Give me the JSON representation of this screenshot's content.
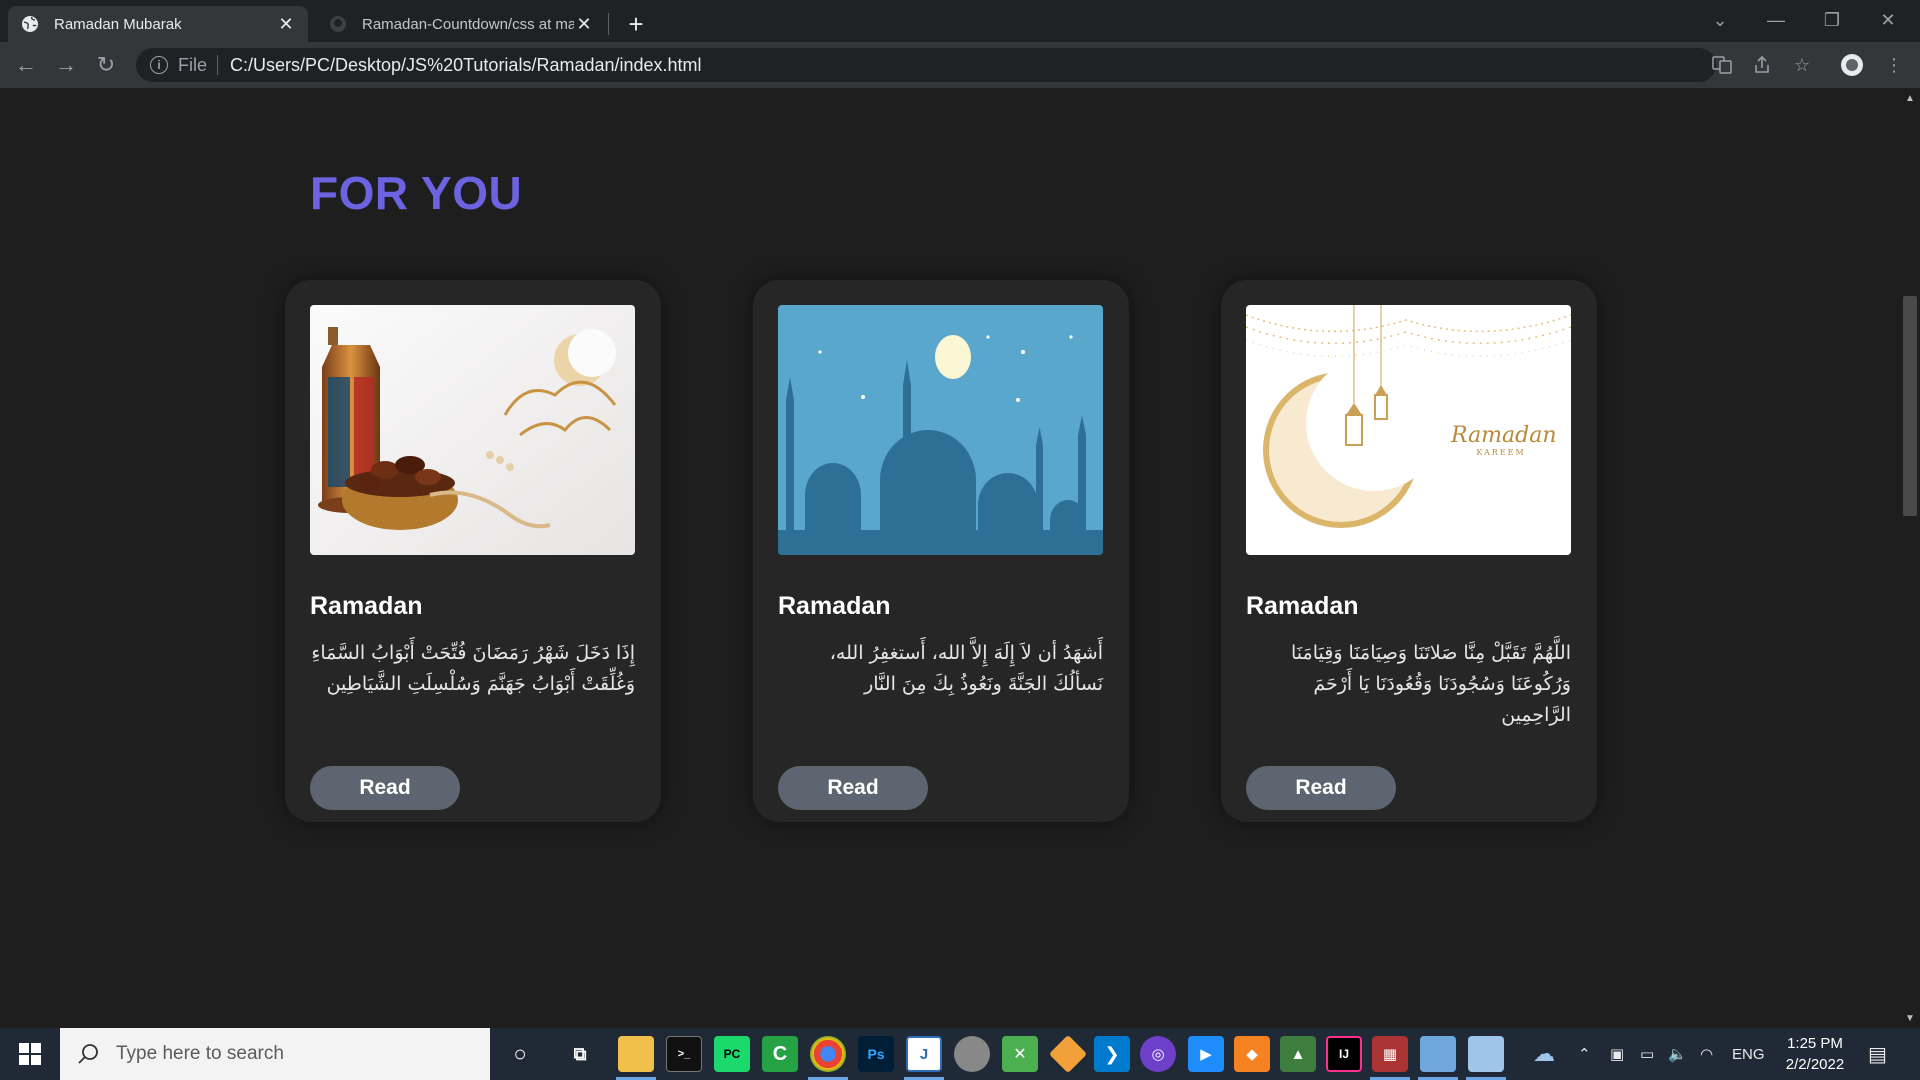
{
  "browser": {
    "tabs": [
      {
        "title": "Ramadan Mubarak",
        "active": true
      },
      {
        "title": "Ramadan-Countdown/css at main",
        "active": false
      }
    ],
    "address": {
      "scheme_label": "File",
      "url": "C:/Users/PC/Desktop/JS%20Tutorials/Ramadan/index.html"
    }
  },
  "page": {
    "section_title": "FOR YOU",
    "accent_color": "#6c63e0",
    "cards": [
      {
        "image": "lantern-dates-ramadan-kareem-image",
        "title": "Ramadan",
        "text": "إِذَا دَخَلَ شَهْرُ رَمَضَانَ فُتِّحَتْ أَبْوَابُ السَّمَاءِ وَغُلِّقَتْ أَبْوَابُ جَهَنَّمَ وَسُلْسِلَتِ الشَّيَاطِين",
        "button": "Read"
      },
      {
        "image": "mosque-silhouette-moon-image",
        "title": "Ramadan",
        "text": "أَشهَدُ أن لاَ إِلَهَ إِلاَّ الله، أَستغفِرُ الله، نَسألُكَ الجَنَّةَ ونَعُوذُ بِكَ مِنَ النَّار",
        "button": "Read"
      },
      {
        "image": "crescent-lanterns-ramadan-kareem-image",
        "image_text": "Ramadan",
        "image_subtext": "KAREEM",
        "title": "Ramadan",
        "text": "اللَّهُمَّ تَقَبَّلْ مِنَّا صَلاتَنَا وَصِيَامَنَا وَقِيَامَنَا وَرُكُوعَنَا وَسُجُودَنَا وَقُعُودَنَا يَا أَرْحَمَ الرَّاحِمِين",
        "button": "Read"
      }
    ]
  },
  "taskbar": {
    "search_placeholder": "Type here to search",
    "language": "ENG",
    "time": "1:25 PM",
    "date": "2/2/2022"
  }
}
